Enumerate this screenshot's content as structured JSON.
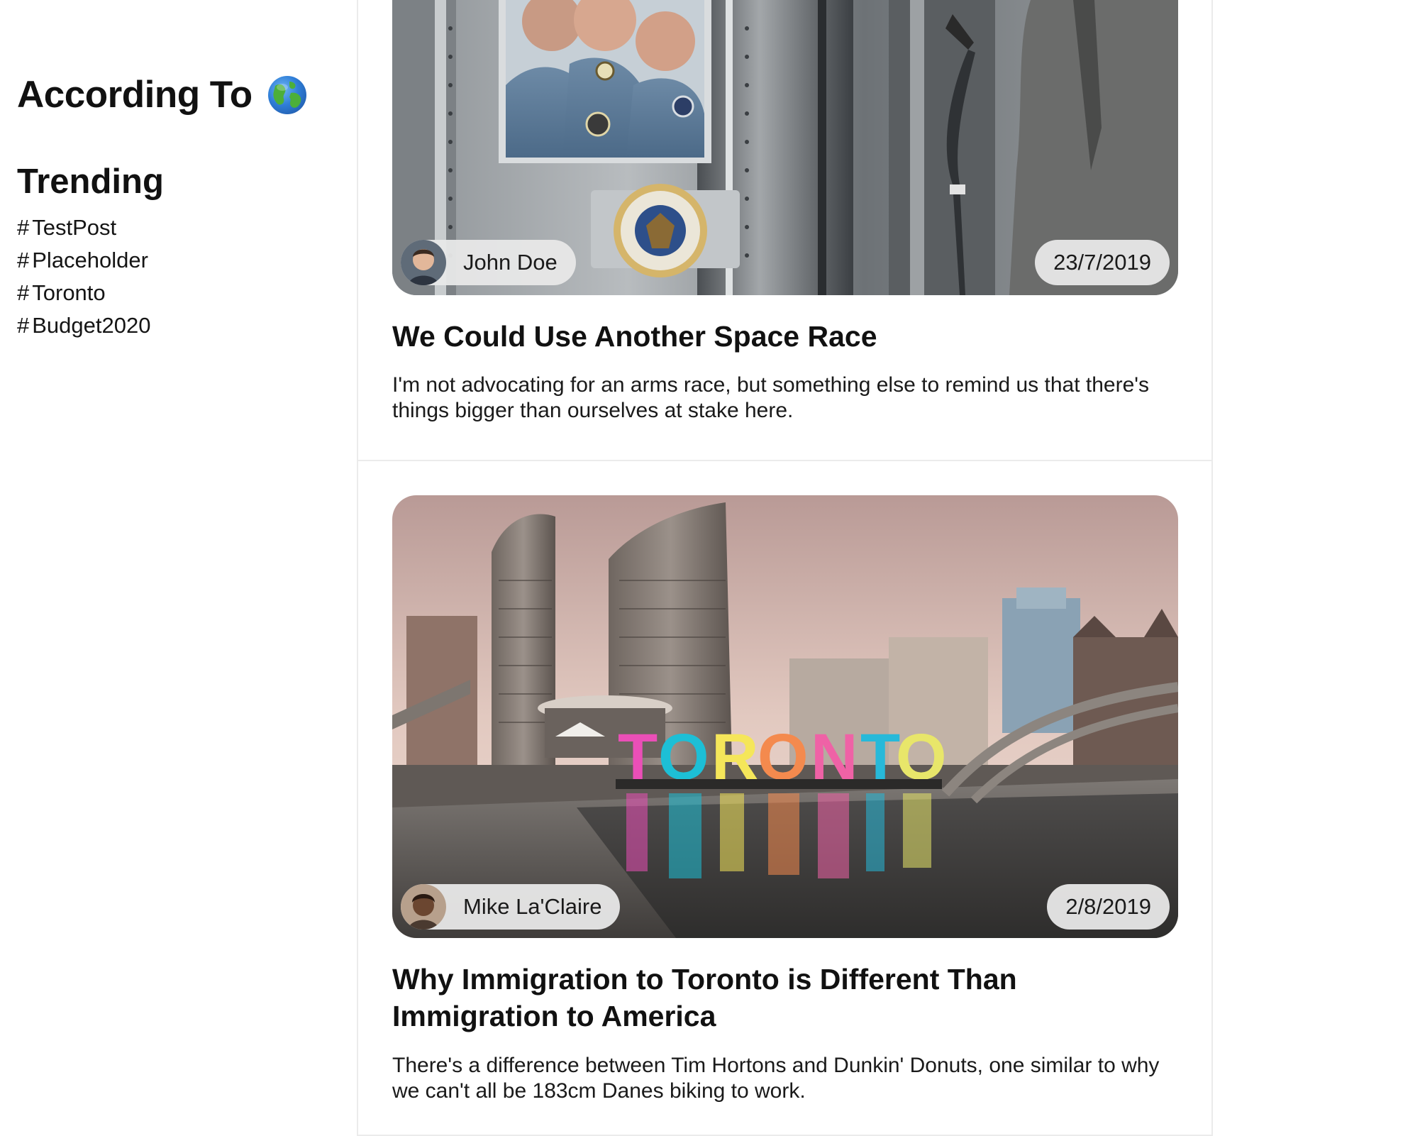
{
  "sidebar": {
    "brand": "According To",
    "globe_icon": "globe-icon",
    "trending_title": "Trending",
    "tags": [
      {
        "hash": "#",
        "label": "TestPost"
      },
      {
        "hash": "#",
        "label": "Placeholder"
      },
      {
        "hash": "#",
        "label": "Toronto"
      },
      {
        "hash": "#",
        "label": "Budget2020"
      }
    ]
  },
  "posts": [
    {
      "author": "John Doe",
      "date": "23/7/2019",
      "title": "We Could Use Another Space Race",
      "excerpt": "I'm not advocating for an arms race, but something else to remind us that there's things bigger than ourselves at stake here."
    },
    {
      "author": "Mike La'Claire",
      "date": "2/8/2019",
      "title": "Why Immigration to Toronto is Different Than Immigration to America",
      "excerpt": "There's a difference between Tim Hortons and Dunkin' Donuts, one similar to why we can't all be 183cm Danes biking to work."
    }
  ]
}
